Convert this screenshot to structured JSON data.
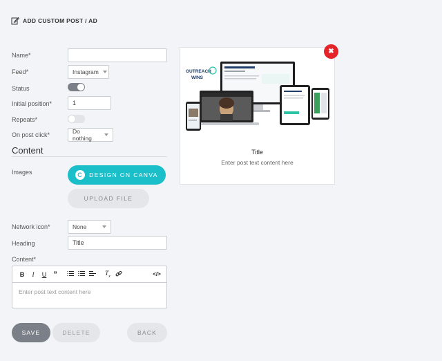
{
  "header": {
    "title": "ADD CUSTOM POST / AD",
    "icon": "edit-icon"
  },
  "form": {
    "name_label": "Name*",
    "name_value": "",
    "feed_label": "Feed*",
    "feed_value": "Instagram",
    "status_label": "Status",
    "status_on": true,
    "initial_position_label": "Initial position*",
    "initial_position_value": "1",
    "repeats_label": "Repeats*",
    "repeats_on": false,
    "on_post_click_label": "On post click*",
    "on_post_click_value": "Do nothing"
  },
  "content": {
    "section_title": "Content",
    "images_label": "Images",
    "design_on_canva": "DESIGN ON CANVA",
    "upload_file": "UPLOAD FILE",
    "network_icon_label": "Network icon*",
    "network_icon_value": "None",
    "heading_label": "Heading",
    "heading_value": "Title",
    "content_label": "Content*",
    "content_placeholder": "Enter post text content here"
  },
  "actions": {
    "save": "SAVE",
    "delete": "DELETE",
    "back": "BACK"
  },
  "preview": {
    "title": "Title",
    "text": "Enter post text content here",
    "image_text": {
      "brand_top": "OUTREACH",
      "brand_bottom": "WINS"
    }
  },
  "colors": {
    "accent": "#1bbfc9",
    "toggle_on": "#7b7f88",
    "close": "#e5242a",
    "save": "#7b7f88"
  }
}
